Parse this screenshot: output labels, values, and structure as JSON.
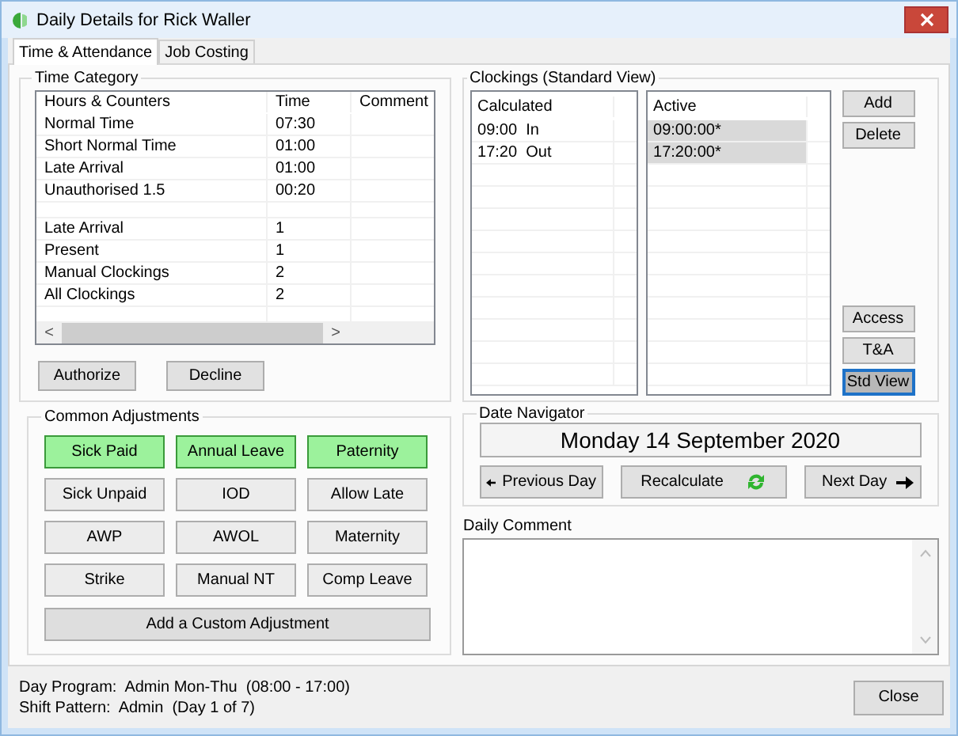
{
  "window": {
    "title": "Daily Details for Rick Waller"
  },
  "tabs": [
    {
      "label": "Time & Attendance",
      "selected": true
    },
    {
      "label": "Job Costing",
      "selected": false
    }
  ],
  "time_category": {
    "title": "Time Category",
    "columns": [
      "Hours & Counters",
      "Time",
      "Comment"
    ],
    "groups": [
      [
        {
          "name": "Normal Time",
          "time": "07:30"
        },
        {
          "name": "Short Normal Time",
          "time": "01:00"
        },
        {
          "name": "Late Arrival",
          "time": "01:00"
        },
        {
          "name": "Unauthorised 1.5",
          "time": "00:20"
        }
      ],
      [
        {
          "name": "Late Arrival",
          "time": "1"
        },
        {
          "name": "Present",
          "time": "1"
        },
        {
          "name": "Manual Clockings",
          "time": "2"
        },
        {
          "name": "All Clockings",
          "time": "2"
        }
      ]
    ],
    "scroll_left": "<",
    "scroll_right": ">",
    "buttons": [
      "Authorize",
      "Decline"
    ]
  },
  "common_adjustments": {
    "title": "Common Adjustments",
    "buttons": [
      {
        "label": "Sick Paid",
        "selected": true
      },
      {
        "label": "Annual Leave",
        "selected": true
      },
      {
        "label": "Paternity",
        "selected": true
      },
      {
        "label": "Sick Unpaid",
        "selected": false
      },
      {
        "label": "IOD",
        "selected": false
      },
      {
        "label": "Allow Late",
        "selected": false
      },
      {
        "label": "AWP",
        "selected": false
      },
      {
        "label": "AWOL",
        "selected": false
      },
      {
        "label": "Maternity",
        "selected": false
      },
      {
        "label": "Strike",
        "selected": false
      },
      {
        "label": "Manual NT",
        "selected": false
      },
      {
        "label": "Comp Leave",
        "selected": false
      }
    ],
    "custom_button": "Add a Custom Adjustment"
  },
  "clockings": {
    "title": "Clockings (Standard View)",
    "calculated": {
      "heading": "Calculated",
      "rows": [
        {
          "time": "09:00",
          "direction": "In"
        },
        {
          "time": "17:20",
          "direction": "Out"
        }
      ]
    },
    "active": {
      "heading": "Active",
      "rows": [
        {
          "text": "09:00:00*",
          "selected": true
        },
        {
          "text": "17:20:00*",
          "selected": true
        }
      ]
    },
    "top_buttons": [
      {
        "label": "Add",
        "selected": false
      },
      {
        "label": "Delete",
        "selected": false
      }
    ],
    "bottom_buttons": [
      {
        "label": "Access",
        "selected": false
      },
      {
        "label": "T&A",
        "selected": false
      },
      {
        "label": "Std View",
        "selected": true
      }
    ]
  },
  "date_navigator": {
    "title": "Date Navigator",
    "date": "Monday 14 September 2020",
    "previous": "Previous Day",
    "recalculate": "Recalculate",
    "next": "Next Day"
  },
  "daily_comment": {
    "label": "Daily Comment"
  },
  "footer": {
    "day_program": "Day Program:  Admin Mon-Thu  (08:00 - 17:00)",
    "shift_pattern": "Shift Pattern:  Admin  (Day 1 of 7)"
  },
  "close_button": "Close"
}
